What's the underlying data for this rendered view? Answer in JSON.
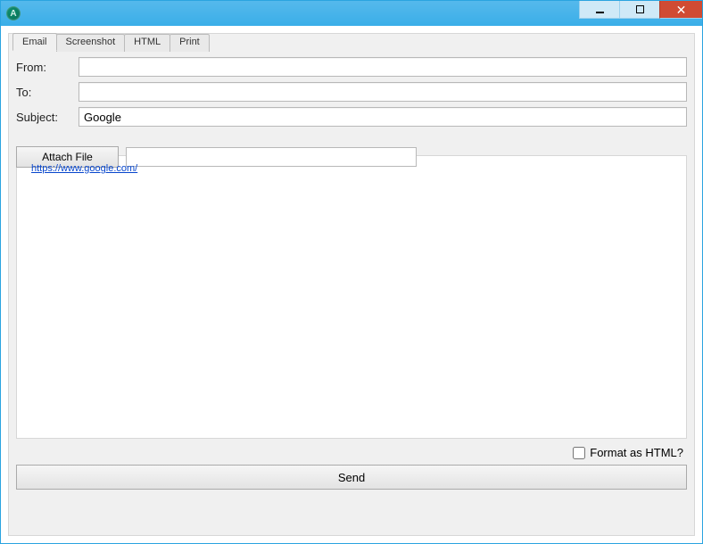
{
  "window": {
    "app_icon_letter": "A"
  },
  "tabs": {
    "items": [
      "Email",
      "Screenshot",
      "HTML",
      "Print"
    ],
    "active_index": 0
  },
  "form": {
    "from_label": "From:",
    "from_value": "",
    "to_label": "To:",
    "to_value": "",
    "subject_label": "Subject:",
    "subject_value": "Google"
  },
  "attach": {
    "button_label": "Attach File",
    "path_value": ""
  },
  "body": {
    "link_text": "https://www.google.com/",
    "link_href": "https://www.google.com/"
  },
  "footer": {
    "format_html_label": "Format as HTML?",
    "format_html_checked": false,
    "send_label": "Send"
  }
}
